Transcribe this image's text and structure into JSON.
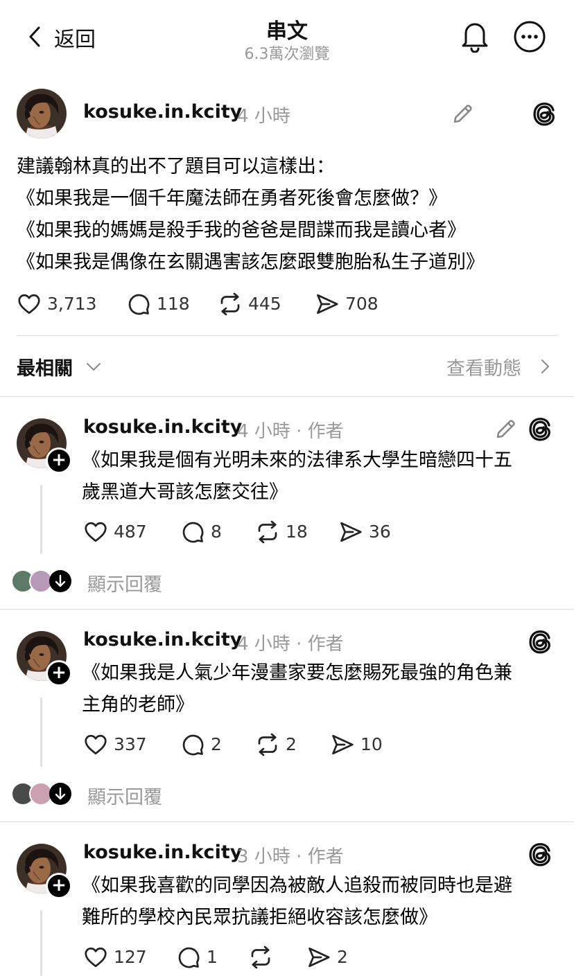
{
  "header": {
    "back_label": "返回",
    "title": "串文",
    "views": "6.3萬次瀏覽"
  },
  "post": {
    "username": "kosuke.in.kcity",
    "time": "4 小時",
    "lines": [
      "建議翰林真的出不了題目可以這樣出：",
      "《如果我是一個千年魔法師在勇者死後會怎麼做？》",
      "《如果我的媽媽是殺手我的爸爸是間諜而我是讀心者》",
      "《如果我是偶像在玄關遇害該怎麼跟雙胞胎私生子道別》"
    ],
    "likes": "3,713",
    "comments": "118",
    "reposts": "445",
    "shares": "708"
  },
  "sort": {
    "label": "最相關",
    "activity_label": "查看動態"
  },
  "replies": [
    {
      "username": "kosuke.in.kcity",
      "time": "4 小時",
      "author_tag": "· 作者",
      "line1": "《如果我是個有光明未來的法律系大學生暗戀四十五",
      "line2": "歲黑道大哥該怎麼交往》",
      "likes": "487",
      "comments": "8",
      "reposts": "18",
      "shares": "36",
      "show_replies": "顯示回覆"
    },
    {
      "username": "kosuke.in.kcity",
      "time": "4 小時",
      "author_tag": "· 作者",
      "line1": "《如果我是人氣少年漫畫家要怎麼賜死最強的角色兼",
      "line2": "主角的老師》",
      "likes": "337",
      "comments": "2",
      "reposts": "2",
      "shares": "10",
      "show_replies": "顯示回覆"
    },
    {
      "username": "kosuke.in.kcity",
      "time": "3 小時",
      "author_tag": "· 作者",
      "line1": "《如果我喜歡的同學因為被敵人追殺而被同時也是避",
      "line2": "難所的學校內民眾抗議拒絕收容該怎麼做》",
      "likes": "127",
      "comments": "1",
      "reposts": "",
      "shares": "2"
    }
  ],
  "colors": {
    "text": "#000000",
    "secondary": "#999999",
    "divider": "#dcdcdc",
    "avatar_skin": "#8a5a3c"
  }
}
